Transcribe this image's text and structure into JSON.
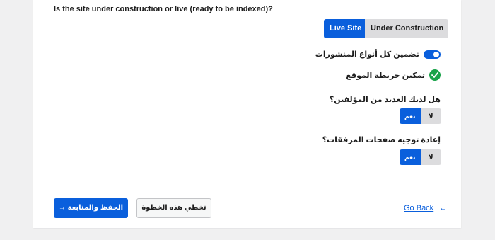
{
  "question_site_status": "Is the site under construction or live (ready to be indexed)?",
  "site_status": {
    "options": [
      "Live Site",
      "Under Construction"
    ],
    "selected": "Live Site"
  },
  "include_all_post_types": {
    "label": "تضمين كل أنواع المنشورات",
    "toggle_on": true
  },
  "enable_sitemap": {
    "label": "تمكين خريطة الموقع",
    "checked": true
  },
  "multiple_authors": {
    "question": "هل لديك العديد من المؤلفين؟",
    "yes_label": "نعم",
    "no_label": "لا",
    "selected": "نعم"
  },
  "redirect_attachments": {
    "question": "إعادة توجيه صفحات المرفقات؟",
    "yes_label": "نعم",
    "no_label": "لا",
    "selected": "نعم"
  },
  "footer": {
    "save_continue_label": "الحفظ والمتابعة →",
    "skip_step_label": "تخطي هذه الخطوة",
    "go_back_label": "Go Back",
    "go_back_arrow": "←"
  },
  "colors": {
    "accent": "#0a5fdc",
    "success": "#1aa34a",
    "inactive": "#dcdcde",
    "background": "#f0f0f1"
  }
}
